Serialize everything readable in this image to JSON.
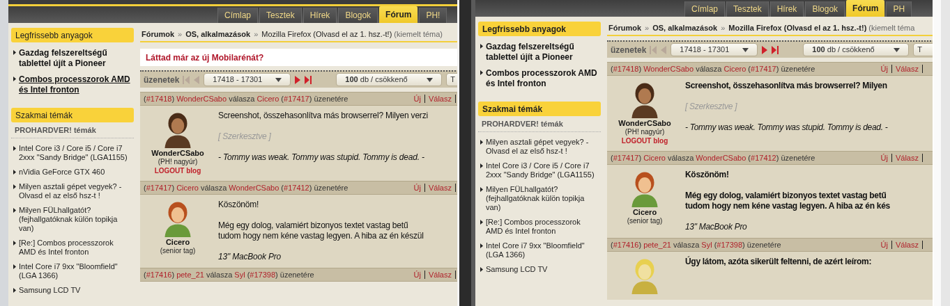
{
  "panels": [
    {
      "header_stripe": true,
      "bold_text": false,
      "tabs": [
        {
          "label": "Címlap",
          "selected": false
        },
        {
          "label": "Tesztek",
          "selected": false
        },
        {
          "label": "Hírek",
          "selected": false
        },
        {
          "label": "Blogok",
          "selected": false
        },
        {
          "label": "Fórum",
          "selected": true
        },
        {
          "label": "PH!",
          "selected": false
        }
      ],
      "sidebar": [
        {
          "kind": "latest",
          "title": "Legfrissebb anyagok",
          "items": [
            {
              "text": "Gazdag felszereltségű tablettel újít a Pioneer",
              "hovered": false
            },
            {
              "text": "Combos processzorok AMD és Intel fronton",
              "hovered": true
            }
          ]
        },
        {
          "kind": "topics",
          "title": "Szakmai témák",
          "subtitle": "PROHARDVER! témák",
          "items": [
            {
              "text": "Intel Core i3 / Core i5 / Core i7 2xxx \"Sandy Bridge\" (LGA1155)",
              "hovered": false
            },
            {
              "text": "nVidia GeForce GTX 460",
              "hovered": false
            },
            {
              "text": "Milyen asztali gépet vegyek? - Olvasd el az első hsz-t !",
              "hovered": false
            },
            {
              "text": "Milyen FÜLhallgatót? (fejhallgatóknak külön topikja van)",
              "hovered": false
            },
            {
              "text": "[Re:] Combos processzorok AMD és Intel fronton",
              "hovered": false
            },
            {
              "text": "Intel Core i7 9xx \"Bloomfield\" (LGA 1366)",
              "hovered": false
            },
            {
              "text": "Samsung LCD TV",
              "hovered": false
            }
          ]
        }
      ],
      "breadcrumb": [
        {
          "kind": "link",
          "text": "Fórumok"
        },
        {
          "kind": "separator",
          "text": "»"
        },
        {
          "kind": "link",
          "text": "OS, alkalmazások"
        },
        {
          "kind": "separator",
          "text": "»"
        },
        {
          "kind": "current",
          "text": "Mozilla Firefox (Olvasd el az 1. hsz.-t!)"
        },
        {
          "kind": "note",
          "text": "(kiemelt téma)"
        }
      ],
      "promo": "Láttad már az új Mobilarénát?",
      "pager": {
        "label": "üzenetek",
        "nav": [
          {
            "kind": "first",
            "disabled": true
          },
          {
            "kind": "prev",
            "disabled": true
          }
        ],
        "range": "17418 - 17301",
        "nav_next": [
          {
            "kind": "next",
            "disabled": false
          },
          {
            "kind": "last",
            "disabled": false
          }
        ],
        "order": "**100** db / csökkenő",
        "extra": "T"
      },
      "posts": [
        {
          "header": [
            {
              "kind": "plain",
              "text": "("
            },
            {
              "kind": "link",
              "text": "#17418"
            },
            {
              "kind": "plain",
              "text": ") "
            },
            {
              "kind": "link",
              "text": "WonderCSabo"
            },
            {
              "kind": "plain",
              "text": " válasza "
            },
            {
              "kind": "link",
              "text": "Cicero"
            },
            {
              "kind": "plain",
              "text": " ("
            },
            {
              "kind": "link",
              "text": "#17417"
            },
            {
              "kind": "plain",
              "text": ") üzenetére"
            }
          ],
          "actions": [
            "Új",
            "Válasz"
          ],
          "user": {
            "name": "WonderCSabo",
            "rank": "(PH! nagyúr)",
            "blog": "LOGOUT blog"
          },
          "body": [
            {
              "kind": "text",
              "text": "Screenshot, összehasonlítva más browserrel? Milyen verzi"
            },
            {
              "kind": "edited",
              "text": "[ Szerkesztve ]"
            },
            {
              "kind": "signature",
              "text": "- Tommy was weak. Tommy was stupid. Tommy is dead. -"
            }
          ]
        },
        {
          "header": [
            {
              "kind": "plain",
              "text": "("
            },
            {
              "kind": "link",
              "text": "#17417"
            },
            {
              "kind": "plain",
              "text": ") "
            },
            {
              "kind": "link",
              "text": "Cicero"
            },
            {
              "kind": "plain",
              "text": " válasza "
            },
            {
              "kind": "link",
              "text": "WonderCSabo"
            },
            {
              "kind": "plain",
              "text": " ("
            },
            {
              "kind": "link",
              "text": "#17412"
            },
            {
              "kind": "plain",
              "text": ") üzenetére"
            }
          ],
          "actions": [
            "Új",
            "Válasz"
          ],
          "user": {
            "name": "Cicero",
            "rank": "(senior tag)"
          },
          "body": [
            {
              "kind": "text",
              "text": "Köszönöm!"
            },
            {
              "kind": "lines",
              "lines": [
                "Még egy dolog, valamiért bizonyos textet vastag betű",
                "tudom hogy nem kéne vastag legyen. A hiba az én készül"
              ]
            },
            {
              "kind": "signature",
              "text": "13\" MacBook Pro"
            }
          ]
        },
        {
          "header": [
            {
              "kind": "plain",
              "text": "("
            },
            {
              "kind": "link",
              "text": "#17416"
            },
            {
              "kind": "plain",
              "text": ") "
            },
            {
              "kind": "link",
              "text": "pete_21"
            },
            {
              "kind": "plain",
              "text": " válasza "
            },
            {
              "kind": "link",
              "text": "Syl"
            },
            {
              "kind": "plain",
              "text": " ("
            },
            {
              "kind": "link",
              "text": "#17398"
            },
            {
              "kind": "plain",
              "text": ") üzenetére"
            }
          ],
          "actions": [
            "Új",
            "Válasz"
          ]
        }
      ]
    },
    {
      "header_stripe": false,
      "bold_text": true,
      "tabs": [
        {
          "label": "Címlap",
          "selected": false
        },
        {
          "label": "Tesztek",
          "selected": false
        },
        {
          "label": "Hírek",
          "selected": false
        },
        {
          "label": "Blogok",
          "selected": false
        },
        {
          "label": "Fórum",
          "selected": true
        },
        {
          "label": "PH",
          "selected": false
        }
      ],
      "sidebar": [
        {
          "kind": "latest",
          "title": "Legfrissebb anyagok",
          "items": [
            {
              "text": "Gazdag felszereltségű tablettel újít a Pioneer",
              "hovered": false
            },
            {
              "text": "Combos processzorok AMD és Intel fronton",
              "hovered": false
            }
          ]
        },
        {
          "kind": "topics",
          "title": "Szakmai témák",
          "subtitle": "PROHARDVER! témák",
          "items": [
            {
              "text": "Milyen asztali gépet vegyek? - Olvasd el az első hsz-t !",
              "hovered": false
            },
            {
              "text": "Intel Core i3 / Core i5 / Core i7 2xxx \"Sandy Bridge\" (LGA1155)",
              "hovered": false
            },
            {
              "text": "Milyen FÜLhallgatót? (fejhallgatóknak külön topikja van)",
              "hovered": false
            },
            {
              "text": "[Re:] Combos processzorok AMD és Intel fronton",
              "hovered": false
            },
            {
              "text": "Intel Core i7 9xx \"Bloomfield\" (LGA 1366)",
              "hovered": false
            },
            {
              "text": "Samsung LCD TV",
              "hovered": false
            }
          ]
        }
      ],
      "breadcrumb": [
        {
          "kind": "link",
          "text": "Fórumok"
        },
        {
          "kind": "separator",
          "text": "»"
        },
        {
          "kind": "link",
          "text": "OS, alkalmazások"
        },
        {
          "kind": "separator",
          "text": "»"
        },
        {
          "kind": "current",
          "text": "Mozilla Firefox (Olvasd el az 1. hsz.-t!)"
        },
        {
          "kind": "note",
          "text": "(kiemelt téma"
        }
      ],
      "pager": {
        "label": "üzenetek",
        "nav": [
          {
            "kind": "first",
            "disabled": true
          },
          {
            "kind": "prev",
            "disabled": true
          }
        ],
        "range": "17418 - 17301",
        "nav_next": [
          {
            "kind": "next",
            "disabled": false
          },
          {
            "kind": "last",
            "disabled": false
          }
        ],
        "order": "**100** db / csökkenő",
        "extra": "T"
      },
      "posts": [
        {
          "header": [
            {
              "kind": "plain",
              "text": "("
            },
            {
              "kind": "link",
              "text": "#17418"
            },
            {
              "kind": "plain",
              "text": ") "
            },
            {
              "kind": "link",
              "text": "WonderCSabo"
            },
            {
              "kind": "plain",
              "text": " válasza "
            },
            {
              "kind": "link",
              "text": "Cicero"
            },
            {
              "kind": "plain",
              "text": " ("
            },
            {
              "kind": "link",
              "text": "#17417"
            },
            {
              "kind": "plain",
              "text": ") üzenetére"
            }
          ],
          "actions": [
            "Új",
            "Válasz"
          ],
          "user": {
            "name": "WonderCSabo",
            "rank": "(PH! nagyúr)",
            "blog": "LOGOUT blog"
          },
          "body": [
            {
              "kind": "text",
              "text": "Screenshot, összehasonlítva más browserrel? Milyen"
            },
            {
              "kind": "edited",
              "text": "[ Szerkesztve ]"
            },
            {
              "kind": "signature",
              "text": "- Tommy was weak. Tommy was stupid. Tommy is dead. -"
            }
          ]
        },
        {
          "header": [
            {
              "kind": "plain",
              "text": "("
            },
            {
              "kind": "link",
              "text": "#17417"
            },
            {
              "kind": "plain",
              "text": ") "
            },
            {
              "kind": "link",
              "text": "Cicero"
            },
            {
              "kind": "plain",
              "text": " válasza "
            },
            {
              "kind": "link",
              "text": "WonderCSabo"
            },
            {
              "kind": "plain",
              "text": " ("
            },
            {
              "kind": "link",
              "text": "#17412"
            },
            {
              "kind": "plain",
              "text": ") üzenetére"
            }
          ],
          "actions": [
            "Új",
            "Válasz"
          ],
          "user": {
            "name": "Cicero",
            "rank": "(senior tag)"
          },
          "body": [
            {
              "kind": "text",
              "text": "Köszönöm!"
            },
            {
              "kind": "lines",
              "lines": [
                "Még egy dolog, valamiért bizonyos textet vastag betű",
                "tudom hogy nem kéne vastag legyen. A hiba az én kés"
              ]
            },
            {
              "kind": "signature",
              "text": "13\" MacBook Pro"
            }
          ]
        },
        {
          "header": [
            {
              "kind": "plain",
              "text": "("
            },
            {
              "kind": "link",
              "text": "#17416"
            },
            {
              "kind": "plain",
              "text": ") "
            },
            {
              "kind": "link",
              "text": "pete_21"
            },
            {
              "kind": "plain",
              "text": " válasza "
            },
            {
              "kind": "link",
              "text": "Syl"
            },
            {
              "kind": "plain",
              "text": " ("
            },
            {
              "kind": "link",
              "text": "#17398"
            },
            {
              "kind": "plain",
              "text": ") üzenetére"
            }
          ],
          "actions": [
            "Új",
            "Válasz"
          ],
          "body": [
            {
              "kind": "text",
              "text": "Úgy látom, azóta sikerült feltenni, de azért leírom:"
            }
          ]
        }
      ]
    }
  ]
}
